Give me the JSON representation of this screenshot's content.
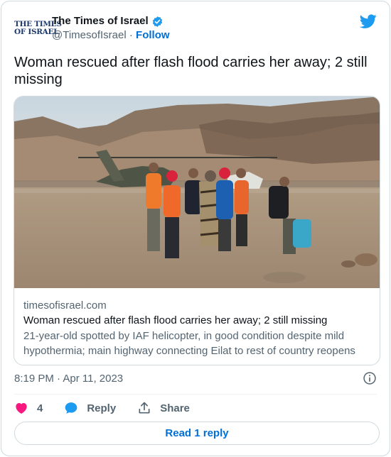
{
  "account": {
    "logo_line1": "THE TIMES",
    "logo_line2": "OF ISRAEL",
    "name": "The Times of Israel",
    "handle": "@TimesofIsrael",
    "separator": " · ",
    "follow_label": "Follow"
  },
  "tweet": {
    "text": "Woman rescued after flash flood carries her away; 2 still missing"
  },
  "link_card": {
    "domain": "timesofisrael.com",
    "title": "Woman rescued after flash flood carries her away; 2 still missing",
    "description": "21-year-old spotted by IAF helicopter, in good condition despite mild hypothermia; main highway connecting Eilat to rest of country reopens"
  },
  "meta": {
    "timestamp": "8:19 PM · Apr 11, 2023"
  },
  "actions": {
    "like_count": "4",
    "reply_label": "Reply",
    "share_label": "Share"
  },
  "read_replies_label": "Read 1 reply",
  "colors": {
    "brand_blue": "#1d9bf0",
    "link_blue": "#006fd6",
    "like_pink": "#f91880",
    "text_primary": "#0f1419",
    "text_secondary": "#536471",
    "border": "#cfd9de"
  },
  "icons": [
    "verified-badge-icon",
    "twitter-bird-icon",
    "info-icon",
    "heart-icon",
    "reply-bubble-icon",
    "share-icon"
  ]
}
